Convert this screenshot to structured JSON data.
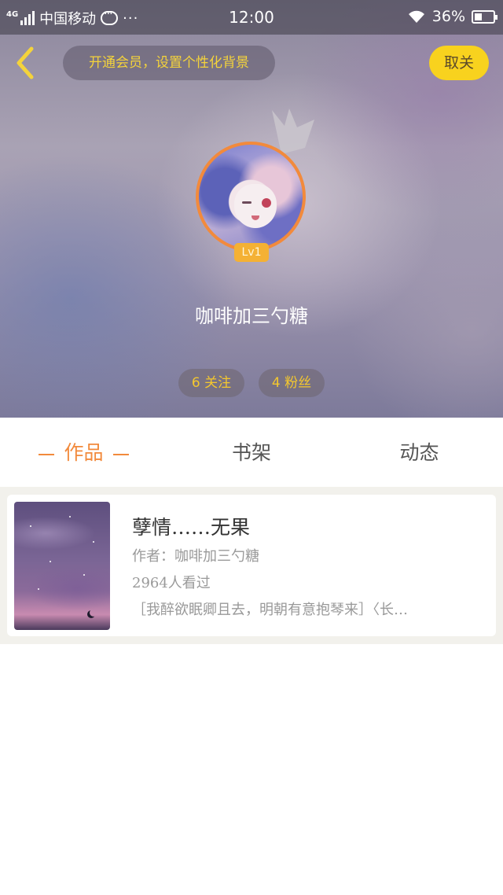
{
  "status_bar": {
    "network": "4G",
    "carrier": "中国移动",
    "more": "···",
    "time": "12:00",
    "battery": "36%"
  },
  "header": {
    "vip_prompt": "开通会员，设置个性化背景",
    "unfollow_label": "取关"
  },
  "profile": {
    "level": "Lv1",
    "username": "咖啡加三勺糖",
    "following": "6 关注",
    "fans": "4 粉丝"
  },
  "tabs": [
    {
      "label": "作品",
      "active": true
    },
    {
      "label": "书架",
      "active": false
    },
    {
      "label": "动态",
      "active": false
    }
  ],
  "works": [
    {
      "title": "孽情……无果",
      "author": "作者：咖啡加三勺糖",
      "views": "2964人看过",
      "description": "［我醉欲眠卿且去，明朝有意抱琴来］〈长…"
    }
  ],
  "colors": {
    "accent_orange": "#f28a3c",
    "accent_yellow": "#f8d21e",
    "text_gray": "#999999"
  }
}
